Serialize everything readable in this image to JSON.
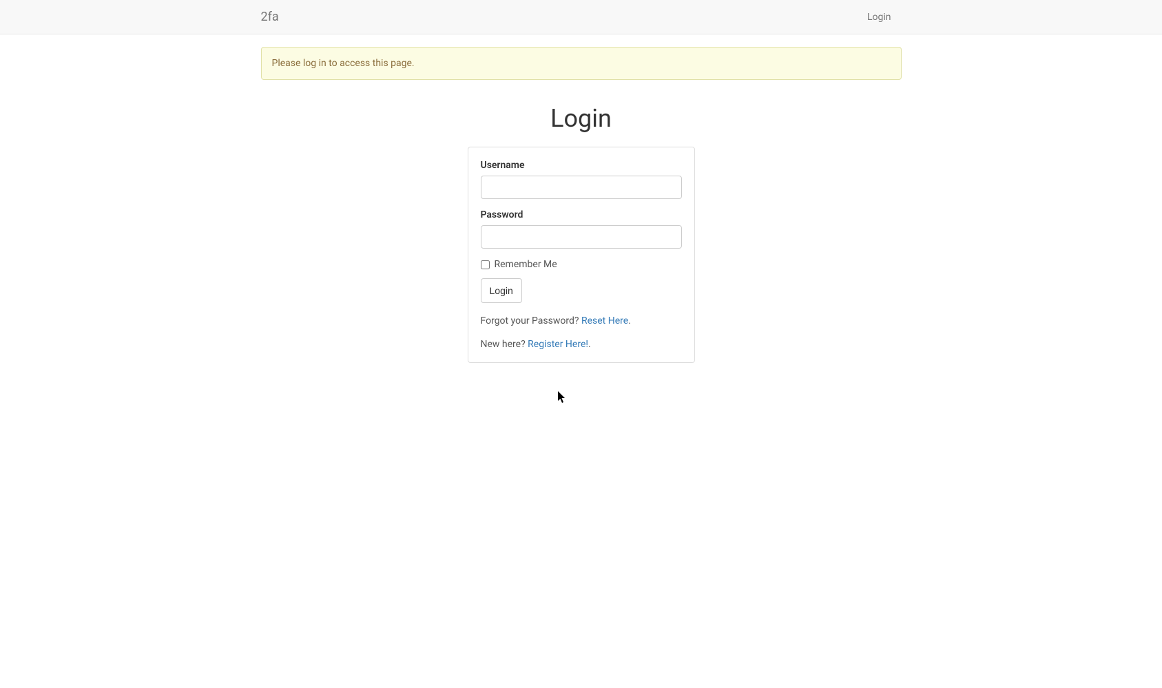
{
  "navbar": {
    "brand": "2fa",
    "login_link": "Login"
  },
  "alert": {
    "message": "Please log in to access this page."
  },
  "page": {
    "title": "Login"
  },
  "form": {
    "username_label": "Username",
    "username_value": "",
    "password_label": "Password",
    "password_value": "",
    "remember_label": "Remember Me",
    "remember_checked": false,
    "submit_label": "Login"
  },
  "helpers": {
    "forgot_prefix": "Forgot your Password? ",
    "forgot_link": "Reset Here",
    "forgot_suffix": ".",
    "register_prefix": "New here? ",
    "register_link": "Register Here!",
    "register_suffix": "."
  }
}
